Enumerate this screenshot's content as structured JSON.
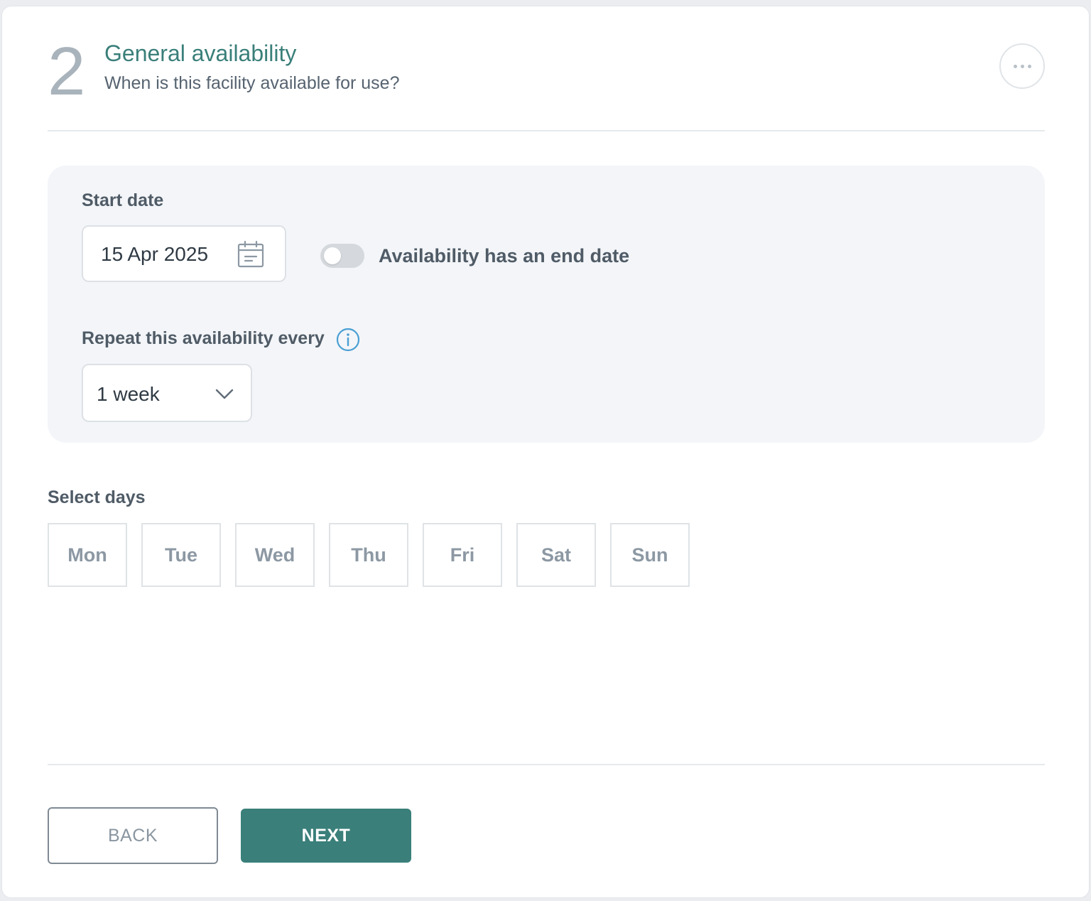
{
  "header": {
    "step_number": "2",
    "title": "General availability",
    "subtitle": "When is this facility available for use?",
    "more_icon": "more-horizontal-icon"
  },
  "availability": {
    "start_date_label": "Start date",
    "start_date_value": "15 Apr 2025",
    "calendar_icon": "calendar-icon",
    "end_date_toggle": {
      "label": "Availability has an end date",
      "on": false
    },
    "repeat_label": "Repeat this availability every",
    "info_icon": "info-icon",
    "repeat_value": "1 week"
  },
  "days": {
    "label": "Select days",
    "items": [
      "Mon",
      "Tue",
      "Wed",
      "Thu",
      "Fri",
      "Sat",
      "Sun"
    ]
  },
  "footer": {
    "back_label": "BACK",
    "next_label": "NEXT"
  },
  "colors": {
    "accent": "#3a7f7a",
    "info": "#4a9fd4",
    "panel": "#f3f5f8"
  }
}
